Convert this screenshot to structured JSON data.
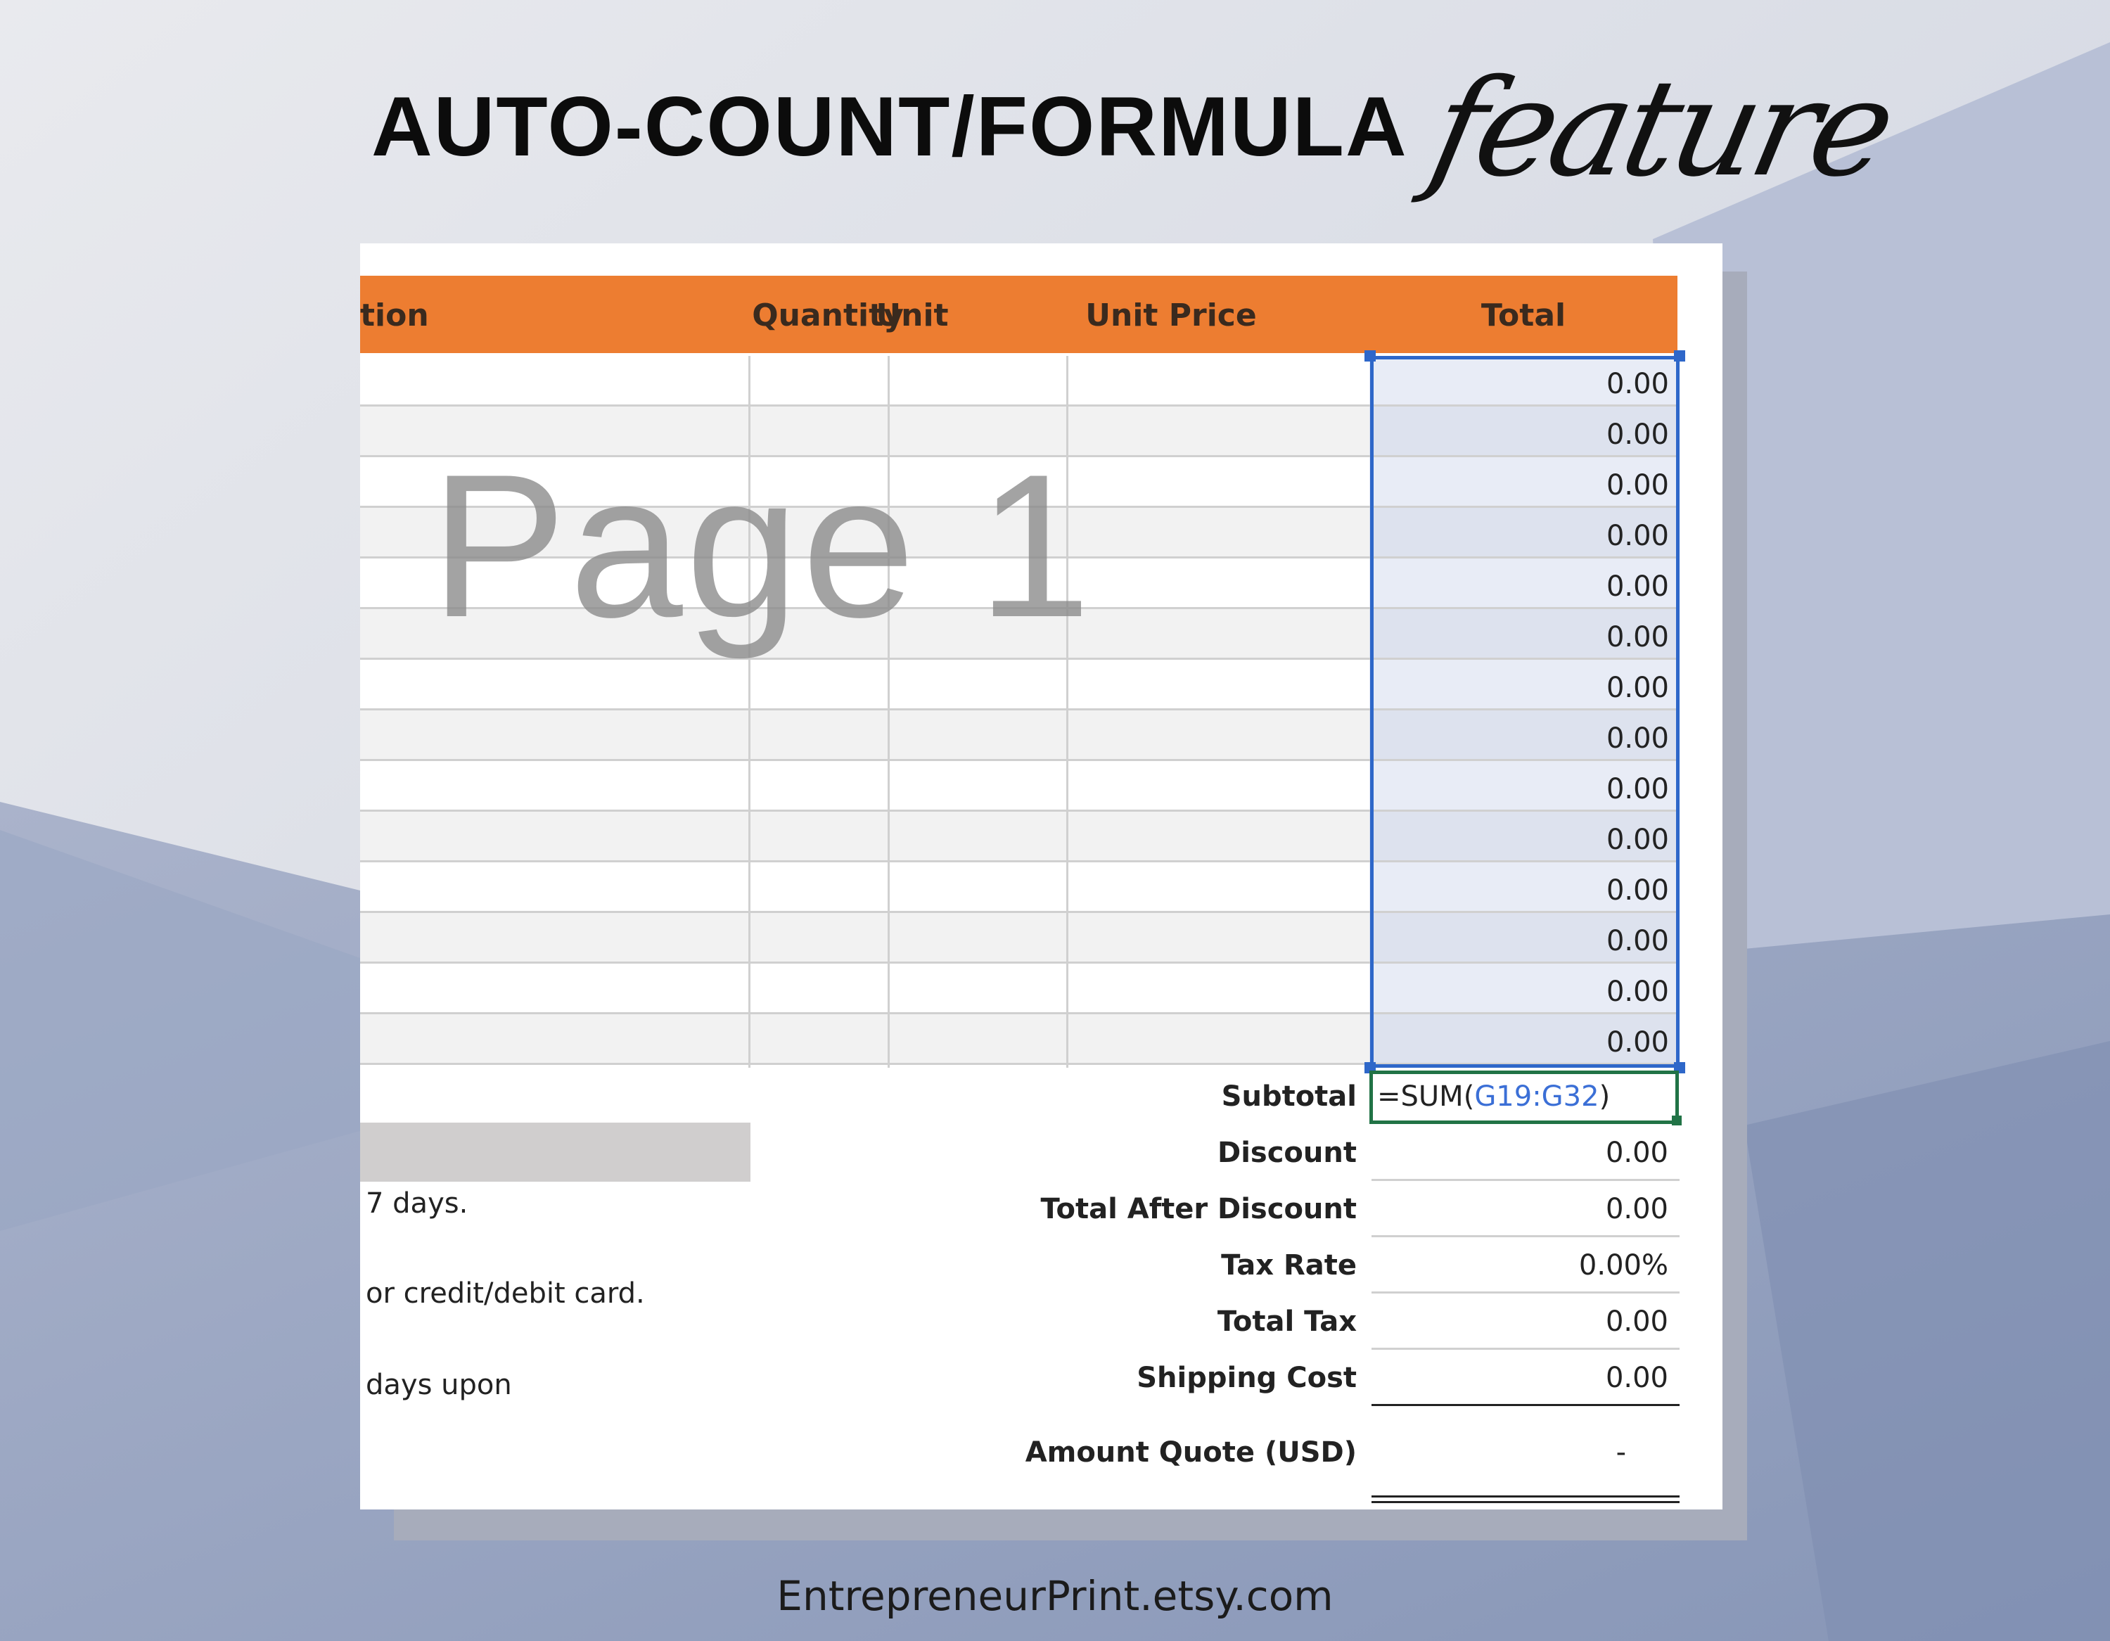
{
  "header": {
    "title": "AUTO-COUNT/FORMULA",
    "script_word": "feature"
  },
  "table": {
    "columns": [
      "tion",
      "Quantity",
      "Unit",
      "Unit Price",
      "Total"
    ],
    "watermark": "Page 1",
    "totals": [
      "0.00",
      "0.00",
      "0.00",
      "0.00",
      "0.00",
      "0.00",
      "0.00",
      "0.00",
      "0.00",
      "0.00",
      "0.00",
      "0.00",
      "0.00",
      "0.00"
    ]
  },
  "summary": {
    "subtotal_label": "Subtotal",
    "formula_prefix": "=SUM(",
    "formula_ref": "G19:G32",
    "formula_suffix": ")",
    "items": [
      {
        "label": "Discount",
        "value": "0.00"
      },
      {
        "label": "Total After Discount",
        "value": "0.00"
      },
      {
        "label": "Tax Rate",
        "value": "0.00%"
      },
      {
        "label": "Total Tax",
        "value": "0.00"
      },
      {
        "label": "Shipping Cost",
        "value": "0.00"
      }
    ],
    "amount_label": "Amount Quote (USD)",
    "amount_value": "-"
  },
  "notes": [
    "7 days.",
    "or credit/debit card.",
    "days upon"
  ],
  "footer": "EntrepreneurPrint.etsy.com",
  "colors": {
    "header_orange": "#ed7d31",
    "selection_blue": "#2e67c9",
    "active_cell_green": "#217346",
    "formula_ref_blue": "#3b6fd6"
  }
}
